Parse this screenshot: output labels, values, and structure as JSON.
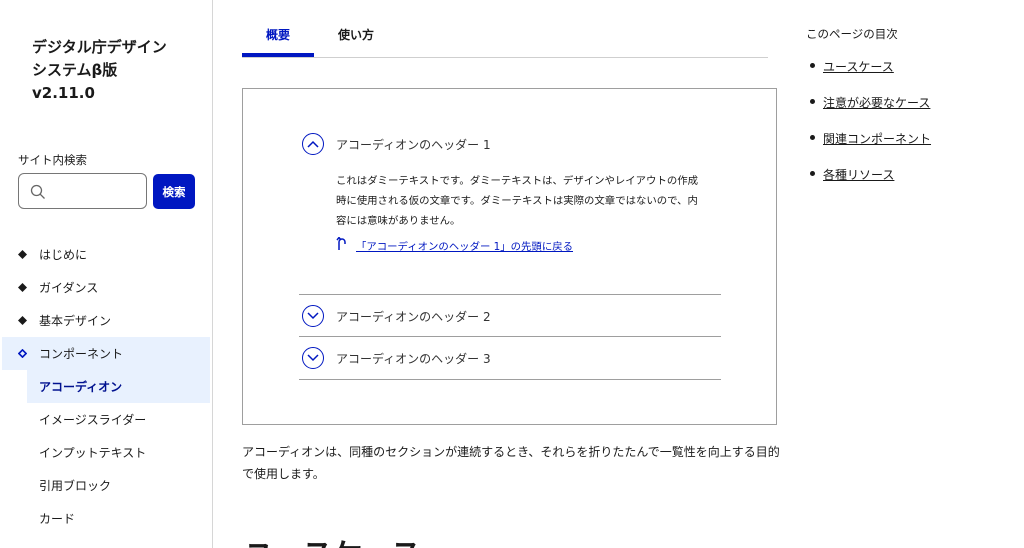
{
  "site": {
    "title_lines": [
      "デジタル庁デザイン",
      "システムβ版",
      "v2.11.0"
    ]
  },
  "search": {
    "label": "サイト内検索",
    "placeholder": "",
    "button_label": "検索"
  },
  "nav": {
    "items": [
      {
        "label": "はじめに"
      },
      {
        "label": "ガイダンス"
      },
      {
        "label": "基本デザイン"
      },
      {
        "label": "コンポーネント"
      }
    ],
    "sub_items": [
      {
        "label": "アコーディオン"
      },
      {
        "label": "イメージスライダー"
      },
      {
        "label": "インプットテキスト"
      },
      {
        "label": "引用ブロック"
      },
      {
        "label": "カード"
      }
    ]
  },
  "tabs": [
    {
      "label": "概要"
    },
    {
      "label": "使い方"
    }
  ],
  "accordion": {
    "items": [
      {
        "title": "アコーディオンのヘッダー 1",
        "expanded": true,
        "body": "これはダミーテキストです。ダミーテキストは、デザインやレイアウトの作成時に使用される仮の文章です。ダミーテキストは実際の文章ではないので、内容には意味がありません。",
        "back_link": "「アコーディオンのヘッダー 1」の先頭に戻る"
      },
      {
        "title": "アコーディオンのヘッダー 2",
        "expanded": false
      },
      {
        "title": "アコーディオンのヘッダー 3",
        "expanded": false
      }
    ]
  },
  "description": "アコーディオンは、同種のセクションが連続するとき、それらを折りたたんで一覧性を向上する目的で使用します。",
  "section_heading": "ユースケース",
  "toc": {
    "title": "このページの目次",
    "items": [
      {
        "label": "ユースケース"
      },
      {
        "label": "注意が必要なケース"
      },
      {
        "label": "関連コンポーネント"
      },
      {
        "label": "各種リソース"
      }
    ]
  },
  "colors": {
    "accent": "#0017c1",
    "active_bg": "#e8f1fe",
    "text": "#1a1a1a"
  }
}
